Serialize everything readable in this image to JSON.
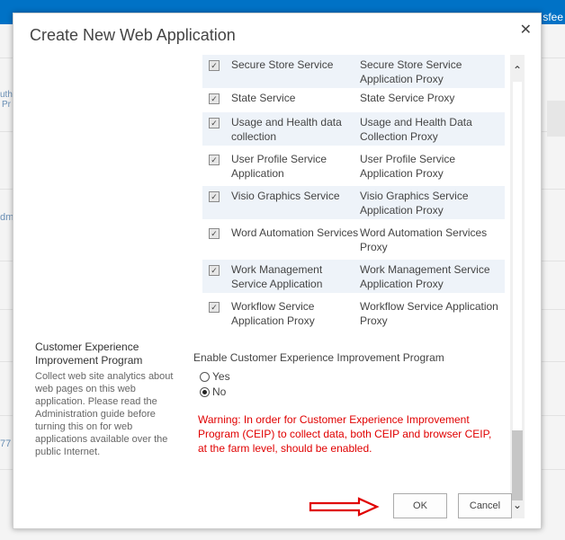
{
  "background": {
    "topbar_text": "sfee",
    "frag1": "uth",
    "frag2": "Pr",
    "frag3": "dm",
    "frag4": "77"
  },
  "dialog": {
    "title": "Create New Web Application",
    "close_glyph": "✕"
  },
  "services": [
    {
      "name": "Secure Store Service",
      "proxy": "Secure Store Service Application Proxy",
      "checked": true
    },
    {
      "name": "State Service",
      "proxy": "State Service Proxy",
      "checked": true
    },
    {
      "name": "Usage and Health data collection",
      "proxy": "Usage and Health Data Collection Proxy",
      "checked": true
    },
    {
      "name": "User Profile Service Application",
      "proxy": "User Profile Service Application Proxy",
      "checked": true
    },
    {
      "name": "Visio Graphics Service",
      "proxy": "Visio Graphics Service Application Proxy",
      "checked": true
    },
    {
      "name": "Word Automation Services",
      "proxy": "Word Automation Services Proxy",
      "checked": true
    },
    {
      "name": "Work Management Service Application",
      "proxy": "Work Management Service Application Proxy",
      "checked": true
    },
    {
      "name": "Workflow Service Application Proxy",
      "proxy": "Workflow Service Application Proxy",
      "checked": true
    }
  ],
  "ceip": {
    "section_title": "Customer Experience Improvement Program",
    "description": "Collect web site analytics about web pages on this web application. Please read the Administration guide before turning this on for web applications available over the public Internet.",
    "field_label": "Enable Customer Experience Improvement Program",
    "option_yes": "Yes",
    "option_no": "No",
    "selected": "No",
    "warning": "Warning: In order for Customer Experience Improvement Program (CEIP) to collect data, both CEIP and browser CEIP, at the farm level, should be enabled."
  },
  "buttons": {
    "ok": "OK",
    "cancel": "Cancel"
  },
  "scrollbar": {
    "up_glyph": "⌃",
    "down_glyph": "⌄"
  },
  "colors": {
    "accent": "#0072c6",
    "warning": "#e00000",
    "arrow": "#e00000",
    "row_shade": "#eef3f9"
  }
}
